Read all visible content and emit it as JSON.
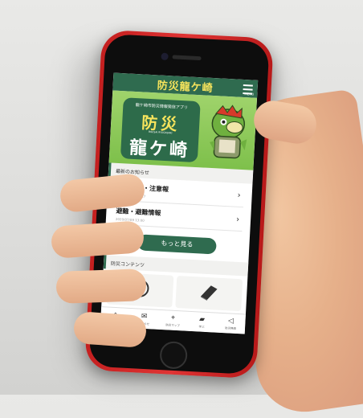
{
  "app": {
    "title": "防災龍ケ崎",
    "menu_label": "MENU"
  },
  "banner": {
    "subtitle": "龍ケ崎市防災情報発信アプリ",
    "title_line1": "防災",
    "romaji": "BOUSAI RYUGASAKI",
    "title_line2": "龍ケ崎"
  },
  "news": {
    "heading": "最新のお知らせ",
    "items": [
      {
        "title": "気象警報・注意報",
        "date": "2020/07/09 12:17"
      },
      {
        "title": "避難・避難情報",
        "date": "2020/07/09 13:00"
      }
    ],
    "more_label": "もっと見る"
  },
  "contents": {
    "heading": "防災コンテンツ"
  },
  "tabbar": {
    "items": [
      {
        "label": "ホーム",
        "icon": "home-icon"
      },
      {
        "label": "お知らせ",
        "icon": "mail-icon"
      },
      {
        "label": "防災マップ",
        "icon": "map-pin-icon"
      },
      {
        "label": "学ぶ",
        "icon": "book-icon"
      },
      {
        "label": "防災無線",
        "icon": "megaphone-icon"
      }
    ]
  },
  "colors": {
    "brand_green": "#2f6b4f",
    "title_yellow": "#f7e45c",
    "phone_red": "#d42a2a"
  }
}
